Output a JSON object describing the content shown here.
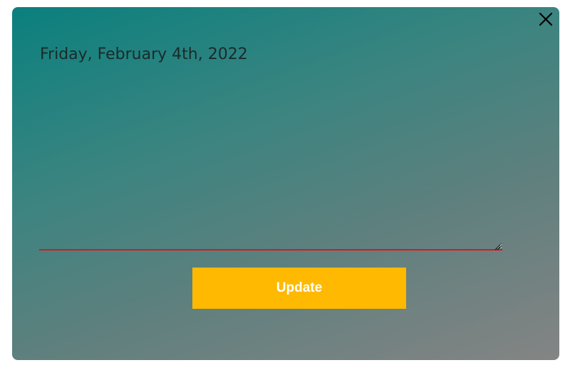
{
  "dialog": {
    "date_text": "Friday, February 4th, 2022",
    "note_value": "",
    "update_label": "Update",
    "close_icon": "close-icon"
  },
  "colors": {
    "accent_button": "#ffb900",
    "underline": "#e0141e",
    "gradient_start": "#0a807e",
    "gradient_end": "#848484"
  }
}
